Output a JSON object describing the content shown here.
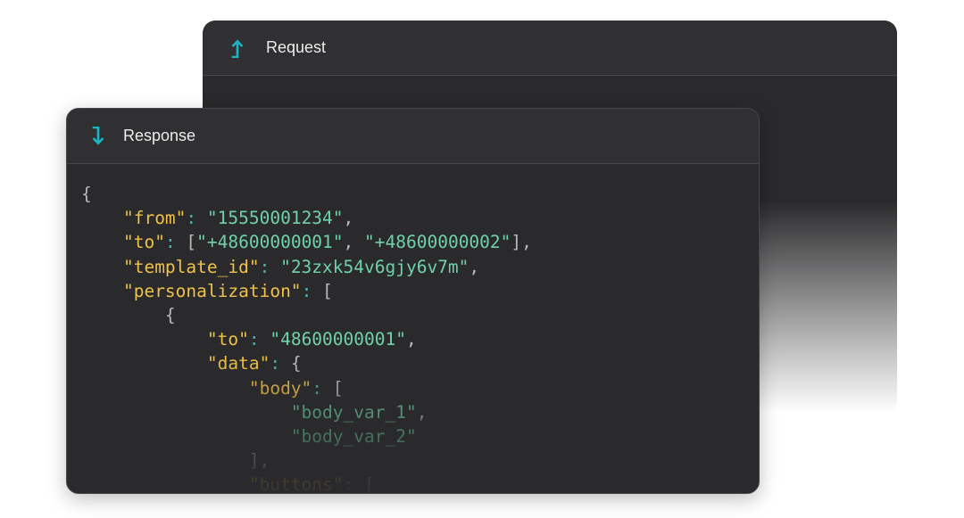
{
  "colors": {
    "panel_bg": "#2a2a2c",
    "header_bg": "#303032",
    "accent_teal": "#19b5c4",
    "key": "#efc14a",
    "string": "#6fd1a8",
    "punct": "#b9b9b9"
  },
  "request": {
    "title": "Request",
    "icon": "arrow-up-icon"
  },
  "response": {
    "title": "Response",
    "icon": "arrow-down-icon",
    "code_lines": [
      [
        {
          "t": "p",
          "v": "{"
        }
      ],
      [
        {
          "t": "p",
          "v": "    "
        },
        {
          "t": "k",
          "v": "\"from\""
        },
        {
          "t": "c",
          "v": ": "
        },
        {
          "t": "s",
          "v": "\"15550001234\""
        },
        {
          "t": "p",
          "v": ","
        }
      ],
      [
        {
          "t": "p",
          "v": "    "
        },
        {
          "t": "k",
          "v": "\"to\""
        },
        {
          "t": "c",
          "v": ": "
        },
        {
          "t": "p",
          "v": "["
        },
        {
          "t": "s",
          "v": "\"+48600000001\""
        },
        {
          "t": "p",
          "v": ", "
        },
        {
          "t": "s",
          "v": "\"+48600000002\""
        },
        {
          "t": "p",
          "v": "],"
        }
      ],
      [
        {
          "t": "p",
          "v": "    "
        },
        {
          "t": "k",
          "v": "\"template_id\""
        },
        {
          "t": "c",
          "v": ": "
        },
        {
          "t": "s",
          "v": "\"23zxk54v6gjy6v7m\""
        },
        {
          "t": "p",
          "v": ","
        }
      ],
      [
        {
          "t": "p",
          "v": "    "
        },
        {
          "t": "k",
          "v": "\"personalization\""
        },
        {
          "t": "c",
          "v": ": "
        },
        {
          "t": "p",
          "v": "["
        }
      ],
      [
        {
          "t": "p",
          "v": "        {"
        }
      ],
      [
        {
          "t": "p",
          "v": "            "
        },
        {
          "t": "k",
          "v": "\"to\""
        },
        {
          "t": "c",
          "v": ": "
        },
        {
          "t": "s",
          "v": "\"48600000001\""
        },
        {
          "t": "p",
          "v": ","
        }
      ],
      [
        {
          "t": "p",
          "v": "            "
        },
        {
          "t": "k",
          "v": "\"data\""
        },
        {
          "t": "c",
          "v": ": "
        },
        {
          "t": "p",
          "v": "{"
        }
      ],
      [
        {
          "t": "p",
          "v": "                "
        },
        {
          "t": "k",
          "v": "\"body\""
        },
        {
          "t": "c",
          "v": ": "
        },
        {
          "t": "p",
          "v": "["
        }
      ],
      [
        {
          "t": "p",
          "v": "                    "
        },
        {
          "t": "s",
          "v": "\"body_var_1\""
        },
        {
          "t": "p",
          "v": ","
        }
      ],
      [
        {
          "t": "p",
          "v": "                    "
        },
        {
          "t": "s",
          "v": "\"body_var_2\""
        }
      ],
      [
        {
          "t": "p",
          "v": "                ],"
        }
      ],
      [
        {
          "t": "p",
          "v": "                "
        },
        {
          "t": "k",
          "v": "\"buttons\""
        },
        {
          "t": "c",
          "v": ": "
        },
        {
          "t": "p",
          "v": "["
        }
      ]
    ]
  }
}
